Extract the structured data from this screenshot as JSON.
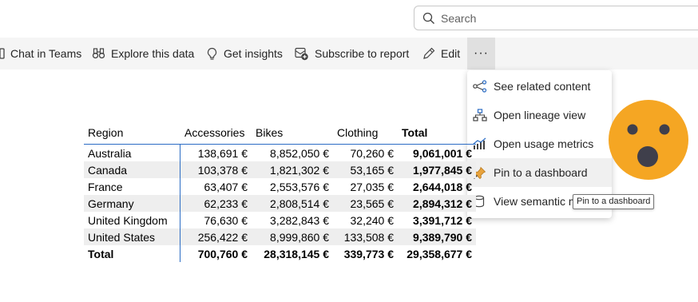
{
  "search": {
    "placeholder": "Search"
  },
  "toolbar": {
    "items": [
      {
        "label": "Chat in Teams",
        "icon": "teams-icon"
      },
      {
        "label": "Explore this data",
        "icon": "binoculars-icon"
      },
      {
        "label": "Get insights",
        "icon": "lightbulb-icon"
      },
      {
        "label": "Subscribe to report",
        "icon": "subscribe-icon"
      },
      {
        "label": "Edit",
        "icon": "pencil-icon"
      }
    ],
    "more_label": "···"
  },
  "menu": {
    "items": [
      {
        "label": "See related content",
        "icon": "related-content-icon"
      },
      {
        "label": "Open lineage view",
        "icon": "lineage-icon"
      },
      {
        "label": "Open usage metrics",
        "icon": "usage-metrics-icon"
      },
      {
        "label": "Pin to a dashboard",
        "icon": "pin-icon"
      },
      {
        "label": "View semantic model",
        "icon": "database-icon"
      }
    ]
  },
  "tooltip": {
    "text": "Pin to a dashboard"
  },
  "table": {
    "headers": [
      "Region",
      "Accessories",
      "Bikes",
      "Clothing",
      "Total"
    ],
    "rows": [
      [
        "Australia",
        "138,691 €",
        "8,852,050 €",
        "70,260 €",
        "9,061,001 €"
      ],
      [
        "Canada",
        "103,378 €",
        "1,821,302 €",
        "53,165 €",
        "1,977,845 €"
      ],
      [
        "France",
        "63,407 €",
        "2,553,576 €",
        "27,035 €",
        "2,644,018 €"
      ],
      [
        "Germany",
        "62,233 €",
        "2,808,514 €",
        "23,565 €",
        "2,894,312 €"
      ],
      [
        "United Kingdom",
        "76,630 €",
        "3,282,843 €",
        "32,240 €",
        "3,391,712 €"
      ],
      [
        "United States",
        "256,422 €",
        "8,999,860 €",
        "133,508 €",
        "9,389,790 €"
      ]
    ],
    "total_row": [
      "Total",
      "700,760 €",
      "28,318,145 €",
      "339,773 €",
      "29,358,677 €"
    ]
  },
  "colors": {
    "accent": "#2b6cc4",
    "emoji": "#f5a623",
    "pin": "#e8a33d"
  }
}
